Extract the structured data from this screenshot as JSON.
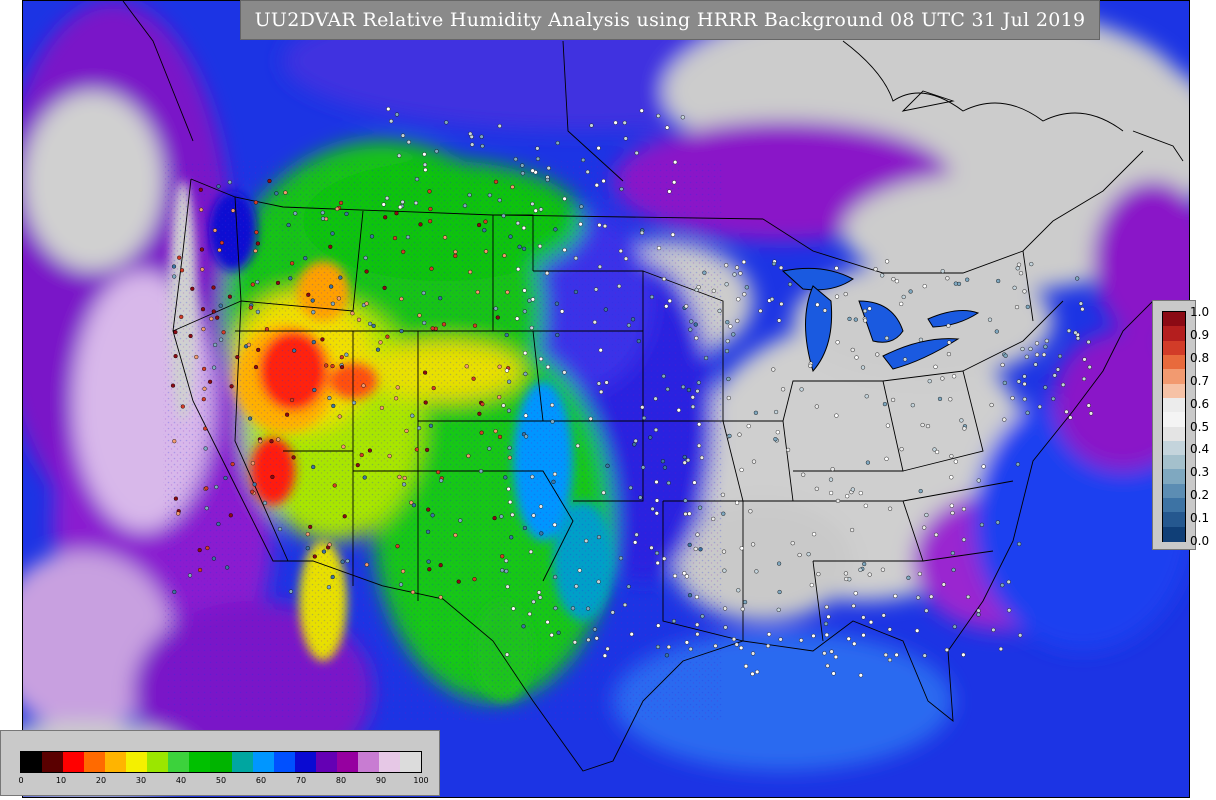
{
  "title": "UU2DVAR Relative Humidity Analysis using HRRR Background 08 UTC 31 Jul 2019",
  "main_colorbar": {
    "ticks": [
      "0",
      "10",
      "20",
      "30",
      "40",
      "50",
      "60",
      "70",
      "80",
      "90",
      "100"
    ],
    "colors": [
      "#000000",
      "#5a0000",
      "#ff0000",
      "#ff6a00",
      "#ffb400",
      "#f4f000",
      "#9be600",
      "#3cd23c",
      "#00c000",
      "#00b400",
      "#00a6a0",
      "#0096ff",
      "#0050ff",
      "#0a0ad2",
      "#6400b4",
      "#9600a0",
      "#c87cd2",
      "#e6c8e6",
      "#dcdcdc"
    ]
  },
  "obs_colorbar": {
    "ticks": [
      "1.0",
      "0.9",
      "0.8",
      "0.7",
      "0.6",
      "0.5",
      "0.4",
      "0.3",
      "0.2",
      "0.1",
      "0.0"
    ],
    "colors": [
      "#8b0a14",
      "#b41e1e",
      "#d23c28",
      "#e86a3c",
      "#f29a70",
      "#f6c2a6",
      "#ececec",
      "#f4f4f4",
      "#e4e4e4",
      "#c4d4dc",
      "#a4c0cc",
      "#7fa8c0",
      "#5c8db3",
      "#3d73a4",
      "#25588f",
      "#103f77"
    ]
  },
  "map_colors": {
    "ocean_deep": "#1030e0",
    "ocean_mid": "#3a44e8",
    "moist_purple": "#8a18c8",
    "light_purple": "#d4a8e4",
    "saturated_gray": "#cccccc",
    "dry_green": "#10c810",
    "drier_yellow": "#e8e000",
    "driest_red": "#ff1010",
    "border": "#000000"
  }
}
